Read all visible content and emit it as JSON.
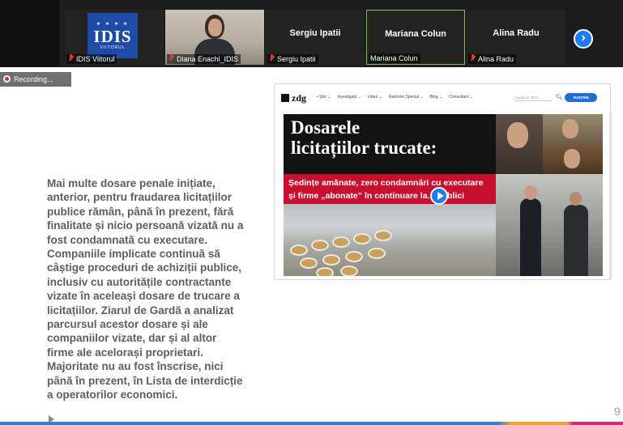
{
  "participants": [
    {
      "name": "IDIS Viitorul",
      "muted": true,
      "logo": {
        "word": "IDIS",
        "sub": "VIITORUL",
        "stars": "★ ★ ★ ★"
      }
    },
    {
      "name": "Diana Enachi_IDIS",
      "muted": true,
      "video": true
    },
    {
      "name": "Sergiu Ipatii",
      "display": "Sergiu Ipatii",
      "muted": true
    },
    {
      "name": "Mariana Colun",
      "display": "Mariana Colun",
      "muted": false,
      "active": true
    },
    {
      "name": "Alina Radu",
      "display": "Alina Radu",
      "muted": true
    }
  ],
  "next_icon": "›",
  "recording_label": "Recording...",
  "slide": {
    "body_lines": [
      "Mai multe dosare penale inițiate,",
      "anterior, pentru fraudarea licitațiilor",
      "publice rămân, până în prezent, fără",
      "finalitate și nicio persoană vizată nu a",
      "fost condamnată cu executare.",
      "Companiile implicate continuă să",
      "câștige proceduri de achiziții publice,",
      "inclusiv cu autoritățile contractante",
      "vizate în aceleași dosare de trucare a",
      "licitațiilor. Ziarul de Gardă a analizat",
      "parcursul acestor dosare și ale",
      "companiilor vizate, dar și al altor",
      "firme ale acelorași proprietari.",
      "Majoritate nu au fost înscrise, nici",
      "până în prezent, în Lista de interdicție",
      "a operatorilor economici."
    ],
    "page_number": "9"
  },
  "website": {
    "logo": "zdg",
    "menu": [
      "• Știri ⌄",
      "Investigații ⌄",
      "Video ⌄",
      "Reporter Special ⌄",
      "Blog ⌄",
      "Consultant ⌄"
    ],
    "search_placeholder": "Caută pe ZDG...",
    "support_button": "SUSȚINE",
    "headline_1": "Dosarele",
    "headline_2": "licitațiilor trucate:",
    "subline_1": "Ședințe amânate, zero condamnări cu executare",
    "subline_2": "și firme „abonate” în continuare la...  publici"
  },
  "colors": {
    "accent_blue": "#1f7cf0",
    "muted_red": "#e53935",
    "active_green": "#7bc144",
    "headline_red": "#c8102e"
  }
}
